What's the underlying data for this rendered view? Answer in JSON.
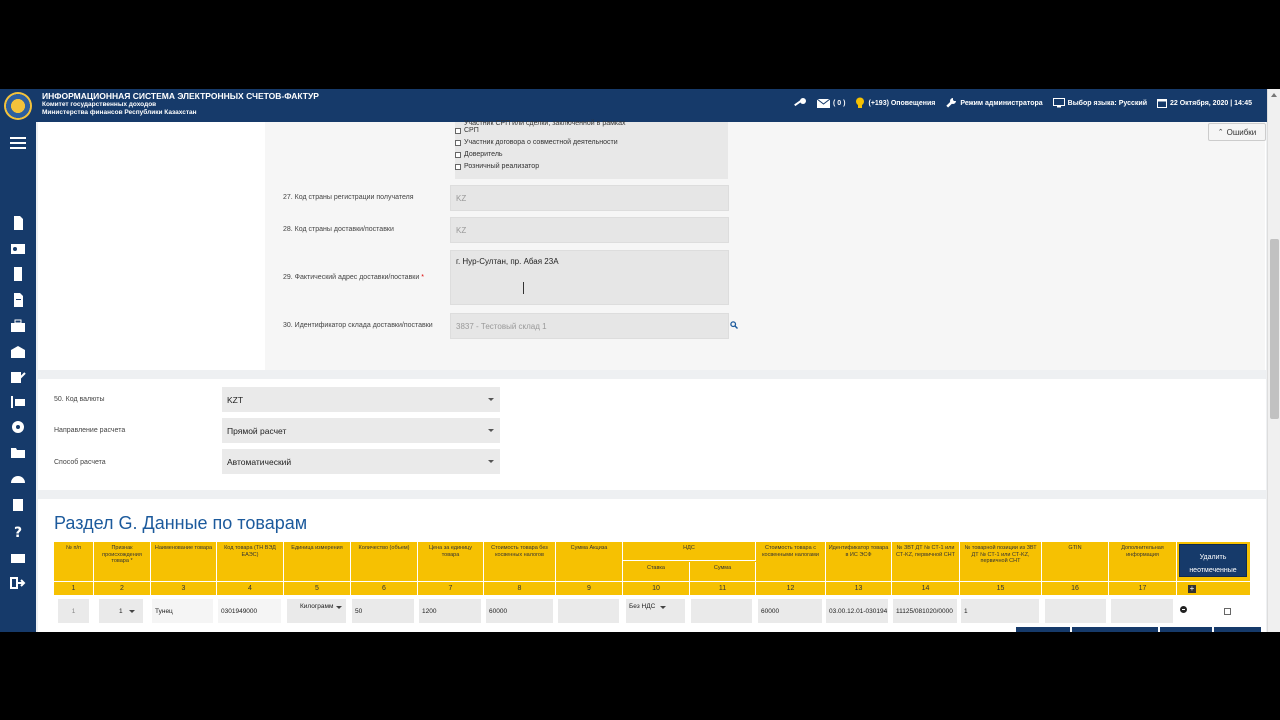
{
  "header": {
    "title": "ИНФОРМАЦИОННАЯ СИСТЕМА ЭЛЕКТРОННЫХ СЧЕТОВ-ФАКТУР",
    "subtitle1": "Комитет государственных доходов",
    "subtitle2": "Министерства финансов Республики Казахстан",
    "mail_count": "( 0 )",
    "notifications": "(+193) Оповещения",
    "admin_mode": "Режим администратора",
    "language": "Выбор языка: Русский",
    "datetime": "22 Октября, 2020 | 14:45"
  },
  "errors_button": "Ошибки",
  "checkboxes": [
    "Участник СРП или сделки, заключенной в рамках",
    "СРП",
    "Участник договора о совместной деятельности",
    "Доверитель",
    "Розничный реализатор"
  ],
  "fields": {
    "f27": {
      "label": "27. Код страны регистрации получателя",
      "value": "KZ"
    },
    "f28": {
      "label": "28. Код страны доставки/поставки",
      "value": "KZ"
    },
    "f29": {
      "label": "29. Фактический адрес доставки/поставки",
      "required": "*",
      "value": "г. Нур-Султан, пр. Абая 23А"
    },
    "f30": {
      "label": "30. Идентификатор склада доставки/поставки",
      "value": "3837 - Тестовый склад 1"
    }
  },
  "currency": {
    "f50_label": "50. Код валюты",
    "f50_value": "KZT",
    "direction_label": "Направление расчета",
    "direction_value": "Прямой расчет",
    "method_label": "Способ расчета",
    "method_value": "Автоматический"
  },
  "section_g": {
    "title": "Раздел G. Данные по товарам",
    "headers": [
      "№ п/п",
      "Признак происхождения товара *",
      "Наименование товара",
      "Код товара (ТН ВЭД ЕАЭС)",
      "Единица измерения",
      "Количество (объем)",
      "Цена за единицу товара",
      "Стоимость товара без косвенных налогов",
      "Сумма Акциза",
      "НДС",
      "Стоимость товара с косвенными налогами",
      "Идентификатор товара в ИС ЭСФ",
      "№ ЗВТ ДТ № СТ-1 или СТ-KZ, первичной СНТ",
      "№ товарной позиции из ЗВТ ДТ № СТ-1 или СТ-KZ, первичной СНТ",
      "GTIN",
      "Дополнительная информация"
    ],
    "vat_rate": "Ставка",
    "vat_sum": "Сумма",
    "delete_button": "Удалить неотмеченные",
    "col_numbers": [
      "1",
      "2",
      "3",
      "4",
      "5",
      "6",
      "7",
      "8",
      "9",
      "10",
      "11",
      "12",
      "13",
      "14",
      "15",
      "16",
      "17"
    ],
    "row": {
      "num": "1",
      "origin": "1",
      "name": "Тунец",
      "code": "0301949000",
      "unit": "Килограмм",
      "qty": "50",
      "price": "1200",
      "cost": "60000",
      "excise": "",
      "vat_rate": "Без НДС",
      "vat_sum": "",
      "cost_with_tax": "60000",
      "id": "03.00.12.01-030194",
      "doc": "11125/081020/0000",
      "pos": "1",
      "gtin": "",
      "info": ""
    }
  }
}
